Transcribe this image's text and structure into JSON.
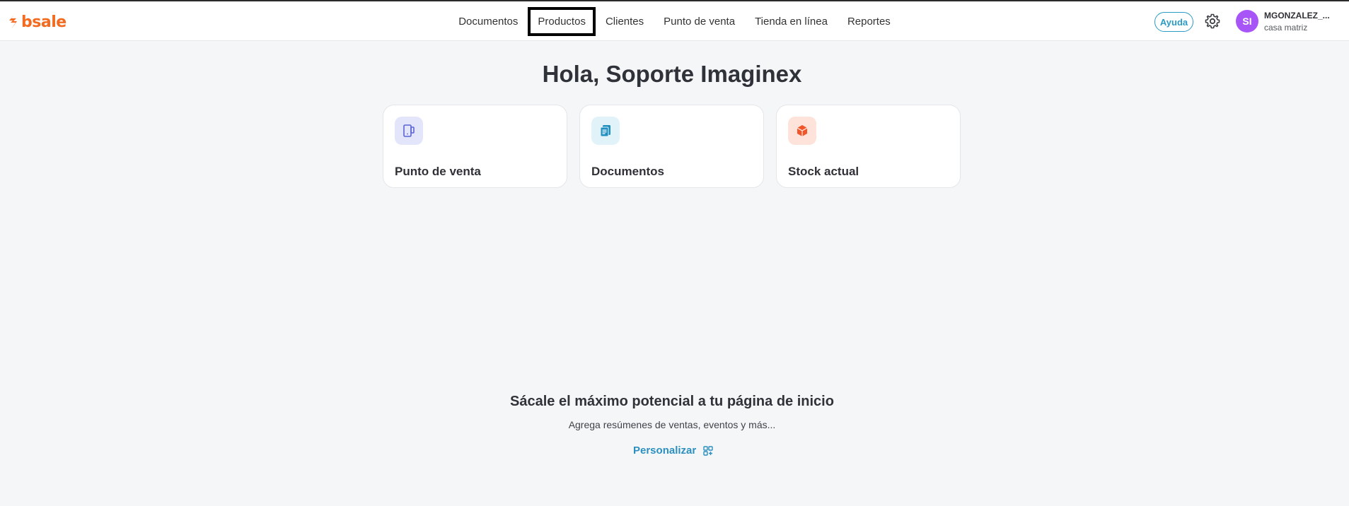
{
  "brand": {
    "name": "bsale",
    "color": "#f26b21"
  },
  "nav": {
    "items": [
      {
        "label": "Documentos"
      },
      {
        "label": "Productos"
      },
      {
        "label": "Clientes"
      },
      {
        "label": "Punto de venta"
      },
      {
        "label": "Tienda en línea"
      },
      {
        "label": "Reportes"
      }
    ]
  },
  "header": {
    "help_label": "Ayuda",
    "settings_icon": "gear-icon",
    "user": {
      "initials": "SI",
      "name": "MGONZALEZ_...",
      "branch": "casa matriz",
      "avatar_color": "#a855f7"
    }
  },
  "main": {
    "greeting": "Hola, Soporte Imaginex",
    "shortcuts": [
      {
        "label": "Punto de venta",
        "icon": "pos-terminal-icon",
        "icon_bg": "#e3e6fb",
        "icon_color": "#5b63d6"
      },
      {
        "label": "Documentos",
        "icon": "document-icon",
        "icon_bg": "#e1f2f9",
        "icon_color": "#1f8fc0"
      },
      {
        "label": "Stock actual",
        "icon": "box-icon",
        "icon_bg": "#fde3d9",
        "icon_color": "#f0562a"
      }
    ],
    "promo": {
      "title": "Sácale el máximo potencial a tu página de inicio",
      "subtitle": "Agrega resúmenes de ventas, eventos y más...",
      "action_label": "Personalizar"
    }
  }
}
